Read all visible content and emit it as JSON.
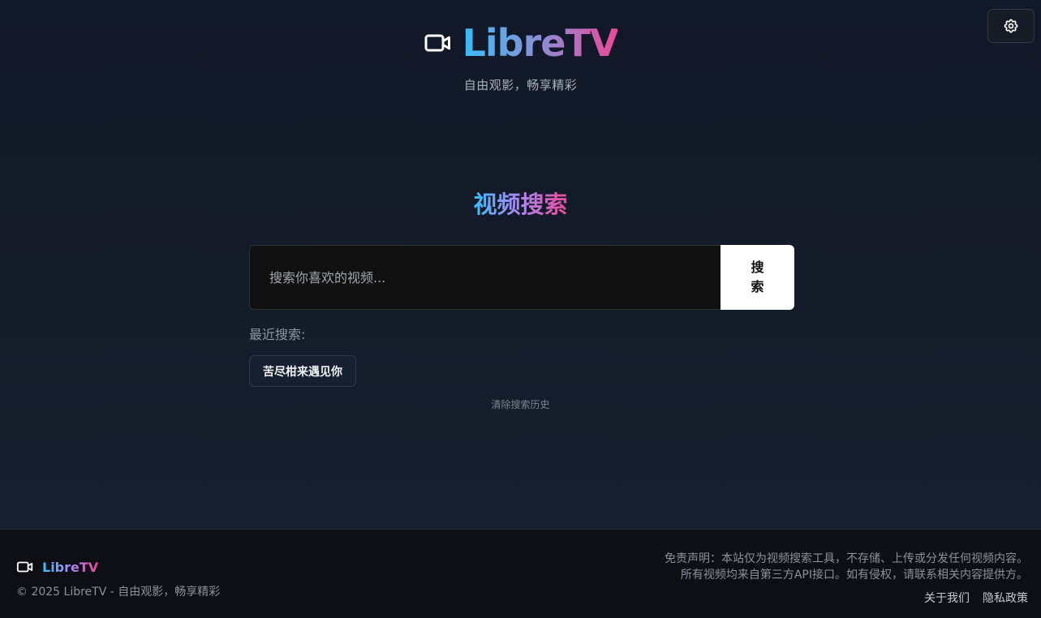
{
  "header": {
    "title": "LibreTV",
    "tagline": "自由观影，畅享精彩",
    "logo_icon": "video-camera-icon"
  },
  "settings": {
    "icon": "gear-icon"
  },
  "search": {
    "heading": "视频搜索",
    "placeholder": "搜索你喜欢的视频...",
    "button_label": "搜索",
    "recent_label": "最近搜索:",
    "recent_items": [
      "苦尽柑来遇见你"
    ],
    "clear_label": "清除搜索历史"
  },
  "footer": {
    "brand": "LibreTV",
    "copyright": "© 2025 LibreTV - 自由观影，畅享精彩",
    "disclaimer_line1": "免责声明：本站仅为视频搜索工具，不存储、上传或分发任何视频内容。",
    "disclaimer_line2": "所有视频均来自第三方API接口。如有侵权，请联系相关内容提供方。",
    "links": [
      "关于我们",
      "隐私政策"
    ]
  },
  "colors": {
    "gradient_start": "#38bdf8",
    "gradient_mid": "#a78bfa",
    "gradient_end": "#ec4899",
    "background": "#111827"
  }
}
